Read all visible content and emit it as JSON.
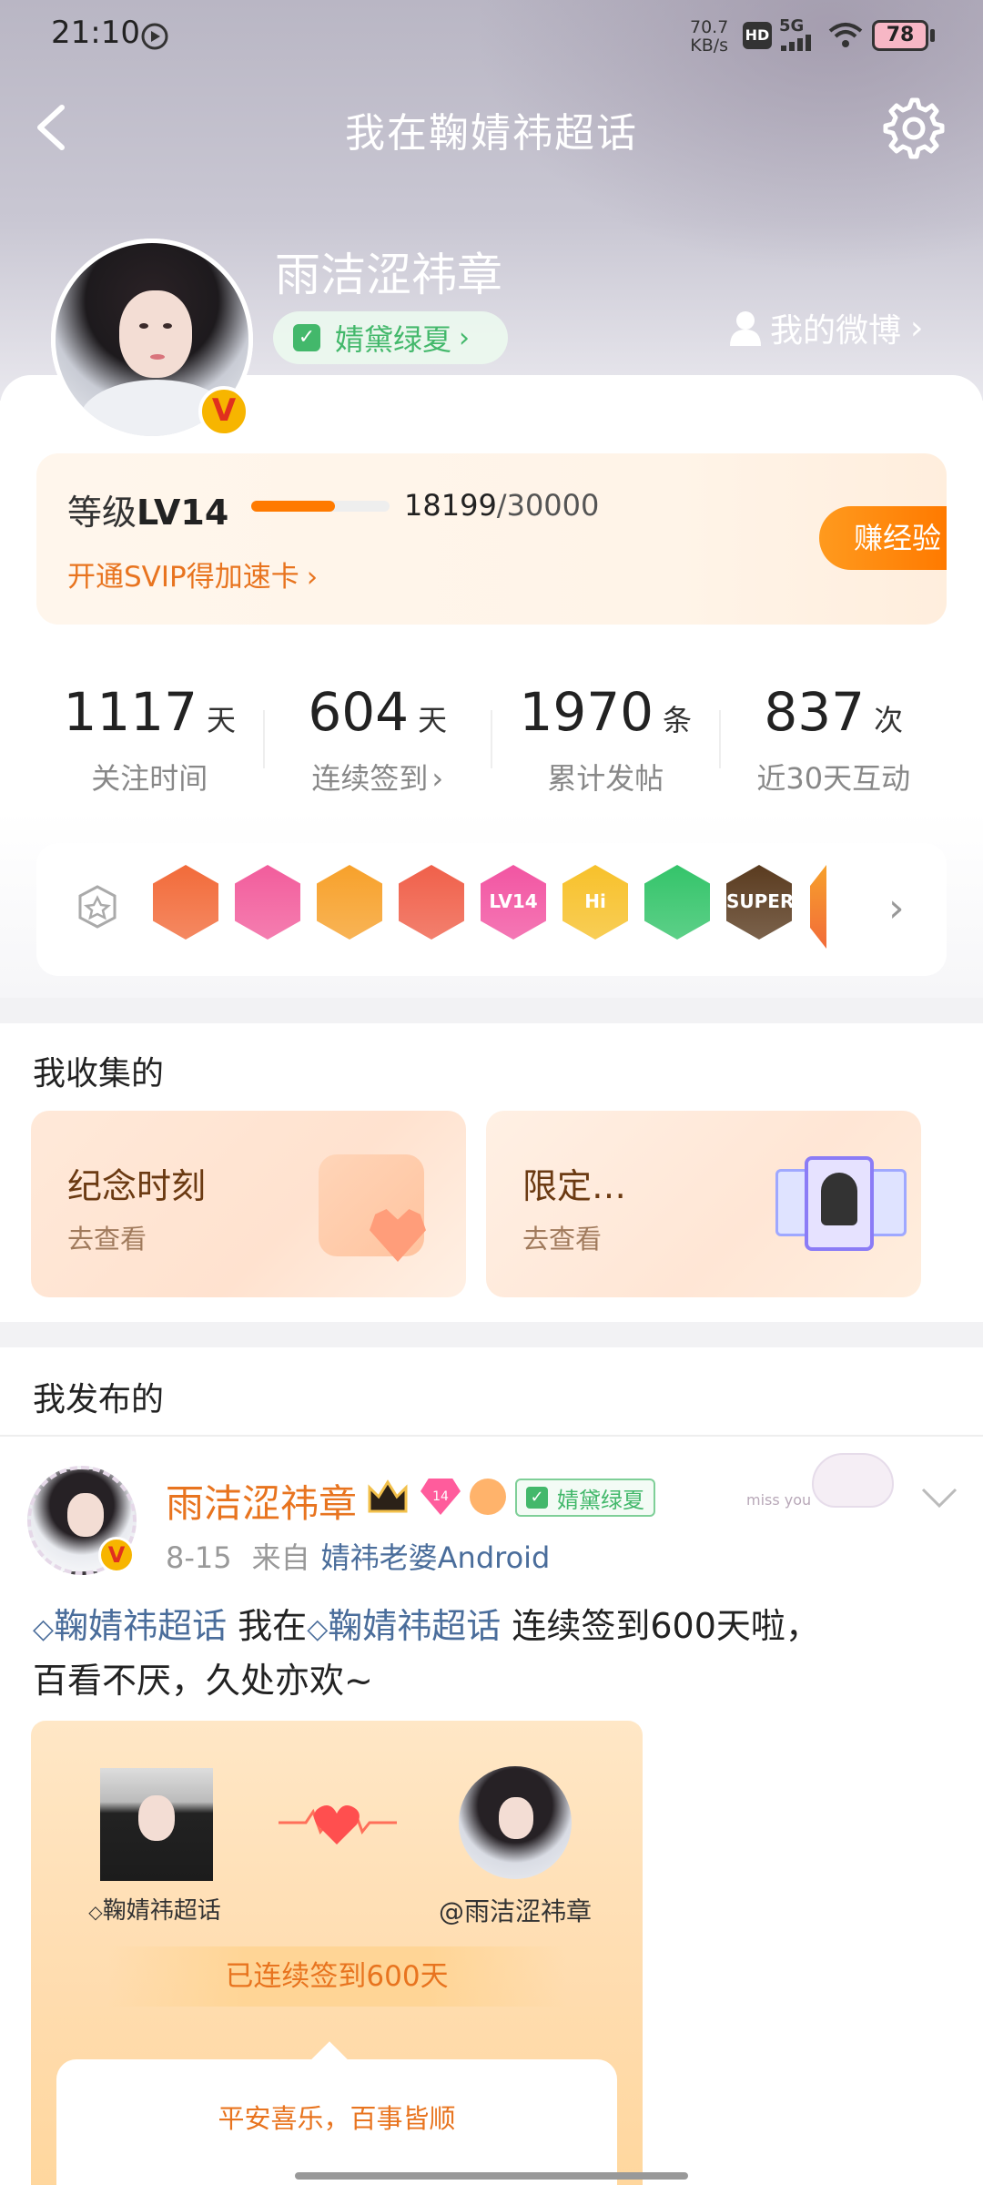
{
  "status_bar": {
    "time": "21:10",
    "net_speed_value": "70.7",
    "net_speed_unit": "KB/s",
    "hd_label": "HD",
    "signal_label": "5G",
    "battery": "78"
  },
  "header": {
    "title": "我在鞠婧祎超话",
    "my_weibo_label": "我的微博"
  },
  "profile": {
    "username": "雨洁涩祎章",
    "fan_badge": "婧黛绿夏",
    "verified_mark": "V"
  },
  "level_card": {
    "level_prefix": "等级",
    "level": "LV14",
    "progress_current": "18199",
    "progress_total": "/30000",
    "progress_fraction": 0.607,
    "svip_promo": "开通SVIP得加速卡",
    "earn_button": "赚经验"
  },
  "stats": [
    {
      "value": "1117",
      "unit": "天",
      "label": "关注时间"
    },
    {
      "value": "604",
      "unit": "天",
      "label": "连续签到"
    },
    {
      "value": "1970",
      "unit": "条",
      "label": "累计发帖"
    },
    {
      "value": "837",
      "unit": "次",
      "label": "近30天互动"
    }
  ],
  "medals": [
    {
      "icon": "fox-medal-icon",
      "color": "#f26b3a",
      "text": ""
    },
    {
      "icon": "crown-pink-medal-icon",
      "color": "#f25d9c",
      "text": ""
    },
    {
      "icon": "crown-orange-medal-icon",
      "color": "#f7a12b",
      "text": ""
    },
    {
      "icon": "cat-medal-icon",
      "color": "#f0604a",
      "text": ""
    },
    {
      "icon": "lv14-medal-icon",
      "color": "#f255a2",
      "text": "LV14"
    },
    {
      "icon": "hi-medal-icon",
      "color": "#f7c12b",
      "text": "Hi"
    },
    {
      "icon": "hand-medal-icon",
      "color": "#34c46a",
      "text": ""
    },
    {
      "icon": "super-medal-icon",
      "color": "#5a3b1f",
      "text": "SUPER"
    }
  ],
  "collected": {
    "title": "我收集的",
    "items": [
      {
        "title": "纪念时刻",
        "subtitle": "去查看"
      },
      {
        "title": "限定…",
        "subtitle": "去查看"
      }
    ]
  },
  "published": {
    "title": "我发布的"
  },
  "post": {
    "author": "雨洁涩祎章",
    "badge": "婧黛绿夏",
    "level_badge": "14",
    "date": "8-15",
    "source_prefix": "来自",
    "source": "婧祎老婆Android",
    "topic1": "鞠婧祎超话",
    "text_mid": " 我在",
    "topic2": "鞠婧祎超话",
    "text_end": " 连续签到600天啦，",
    "text_line2": "百看不厌，久处亦欢~",
    "decor_text": "miss you",
    "card": {
      "left_label": "鞠婧祎超话",
      "right_label": "@雨洁涩祎章",
      "streak": "已连续签到600天",
      "wish": "平安喜乐，百事皆顺"
    }
  },
  "colors": {
    "accent_orange": "#ff8a00",
    "link_blue": "#4a6d9b",
    "author_orange": "#e8741f",
    "badge_green": "#43b86b"
  }
}
